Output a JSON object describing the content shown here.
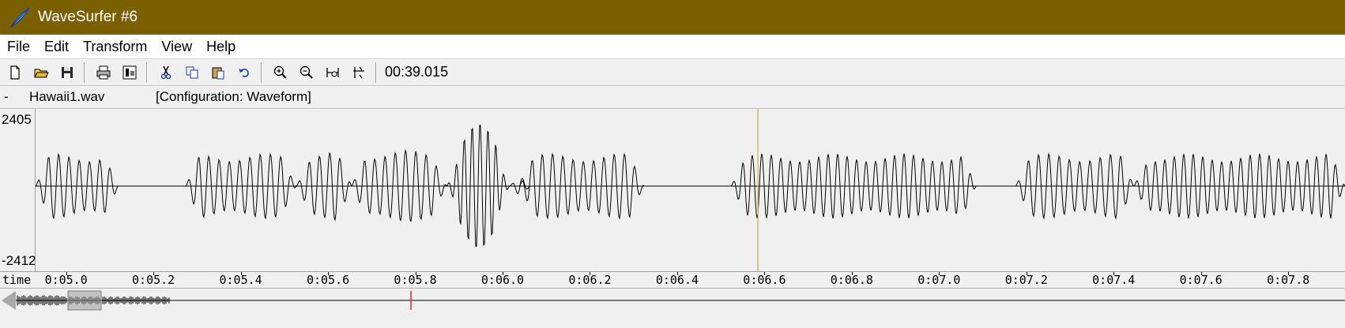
{
  "window": {
    "title": "WaveSurfer #6",
    "app_icon": "wavesurfer-feather-icon",
    "titlebar_color": "#7a6000"
  },
  "menu": {
    "items": [
      "File",
      "Edit",
      "Transform",
      "View",
      "Help"
    ]
  },
  "toolbar": {
    "buttons": [
      "new-file-icon",
      "open-folder-icon",
      "save-icon",
      "print-icon",
      "properties-icon",
      "cut-icon",
      "copy-icon",
      "paste-icon",
      "undo-icon",
      "zoom-in-icon",
      "zoom-out-icon",
      "zoom-to-selection-icon",
      "zoom-all-icon"
    ],
    "time_readout": "00:39.015"
  },
  "file_bar": {
    "dash": "-",
    "filename": "Hawaii1.wav",
    "configuration": "[Configuration: Waveform]"
  },
  "waveform": {
    "y_max_label": "2405",
    "y_min_label": "-2412",
    "cursor_time": 6.585,
    "cursor_color": "#f0a020",
    "view_start": 4.93,
    "view_end": 7.93
  },
  "time_axis": {
    "label": "time",
    "ticks": [
      "0:05.0",
      "0:05.2",
      "0:05.4",
      "0:05.6",
      "0:05.8",
      "0:06.0",
      "0:06.2",
      "0:06.4",
      "0:06.6",
      "0:06.8",
      "0:07.0",
      "0:07.2",
      "0:07.4",
      "0:07.6",
      "0:07.8"
    ],
    "tick_times": [
      5.0,
      5.2,
      5.4,
      5.6,
      5.8,
      6.0,
      6.2,
      6.4,
      6.6,
      6.8,
      7.0,
      7.2,
      7.4,
      7.6,
      7.8
    ]
  },
  "overview": {
    "playhead_color": "#e02020",
    "scroll_left_icon": "scroll-left-arrow-icon"
  }
}
